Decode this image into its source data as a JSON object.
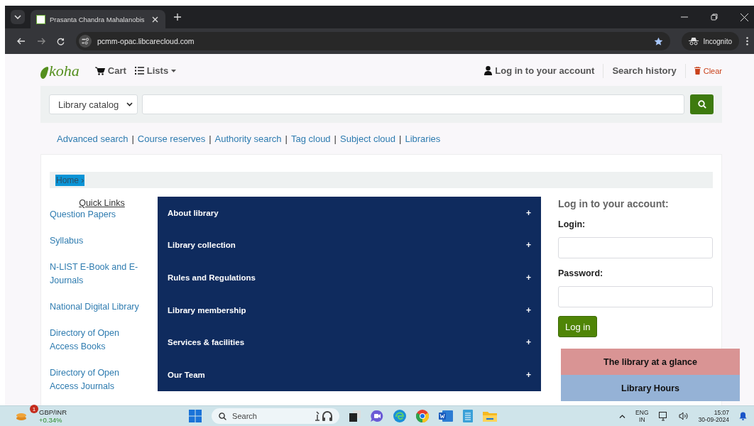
{
  "browser": {
    "tabs": [
      {
        "title": "Prasanta Chandra Mahalanobis",
        "selected": true
      }
    ],
    "url": "pcmm-opac.libcarecloud.com",
    "incognito": "Incognito"
  },
  "header": {
    "logo": "koha",
    "cart": "Cart",
    "lists": "Lists",
    "login": "Log in to your account",
    "history": "Search history",
    "clear": "Clear"
  },
  "search": {
    "scope": "Library catalog"
  },
  "link_separator": "|",
  "links": [
    "Advanced search",
    "Course reserves",
    "Authority search",
    "Tag cloud",
    "Subject cloud",
    "Libraries"
  ],
  "breadcrumb": "Home ›",
  "quick_links": {
    "title": "Quick Links",
    "items": [
      "Question Papers",
      "Syllabus",
      "N-LIST E-Book and E-Journals",
      "National Digital Library",
      "Directory of Open Access Books",
      "Directory of Open Access Journals"
    ]
  },
  "accordion": [
    {
      "label": "About library",
      "toggle": "+"
    },
    {
      "label": "Library collection",
      "toggle": "+"
    },
    {
      "label": "Rules and Regulations",
      "toggle": "+"
    },
    {
      "label": "Library membership",
      "toggle": "+"
    },
    {
      "label": "Services & facilities",
      "toggle": "+"
    },
    {
      "label": "Our Team",
      "toggle": "+"
    }
  ],
  "login": {
    "heading": "Log in to your account:",
    "login_label": "Login:",
    "password_label": "Password:",
    "button": "Log in"
  },
  "side_boxes": [
    {
      "label": "The library at a glance",
      "color": "#d99494"
    },
    {
      "label": "Library Hours",
      "color": "#95b2d6"
    }
  ],
  "taskbar": {
    "widget": {
      "name": "GBP/INR",
      "change": "+0.34%",
      "badge": "1"
    },
    "search": "Search",
    "lang": "ENG",
    "region": "IN",
    "time": "15:07",
    "date": "30-09-2024"
  }
}
